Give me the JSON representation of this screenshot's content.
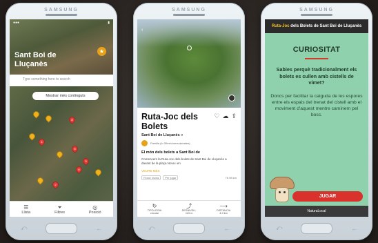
{
  "brand": "SAMSUNG",
  "screen1": {
    "title": "Sant Boi de Lluçanès",
    "search_placeholder": "Type something here to search",
    "more_button": "Mostrar més continguts",
    "tabs": [
      {
        "label": "Llista",
        "icon": "list-icon"
      },
      {
        "label": "Filtres",
        "icon": "filter-icon"
      },
      {
        "label": "Posició",
        "icon": "location-icon"
      }
    ],
    "pins": [
      {
        "color": "yellow"
      },
      {
        "color": "yellow"
      },
      {
        "color": "red",
        "label": "8"
      },
      {
        "color": "yellow"
      },
      {
        "color": "red",
        "label": "4"
      },
      {
        "color": "red",
        "label": "5"
      },
      {
        "color": "yellow"
      },
      {
        "color": "red",
        "label": "3"
      },
      {
        "color": "red",
        "label": "6"
      },
      {
        "color": "yellow"
      },
      {
        "color": "red",
        "label": "2"
      },
      {
        "color": "yellow"
      }
    ]
  },
  "screen2": {
    "photo_credit": "© ",
    "title": "Ruta-Joc dels Bolets",
    "location_link": "Sant Boi de Lluçanès »",
    "author": "Família (in 30min toma durades)",
    "heading": "El món dels bolets a Sant Boi de",
    "description": "Comencem la Ruta-Joc dels bolets de Sant Boi de Lluçanès a davant de la plaça Nova i en",
    "read_more": "VEURE MÉS",
    "tags": [
      "Flora i fauna",
      "Per jugar"
    ],
    "distance_tag": "76.98 km",
    "stats": [
      {
        "icon": "loop-icon",
        "label": "TIPOLOGIA",
        "value": "circular"
      },
      {
        "icon": "elevation-icon",
        "label": "DESNIVELL",
        "value": "120 m"
      },
      {
        "icon": "distance-icon",
        "label": "DISTÀNCIA",
        "value": "4.0 km"
      }
    ]
  },
  "screen3": {
    "header_prefix": "Ruta-Joc",
    "header_rest": " dels Bolets de Sant Boi de Lluçanès",
    "section": "CURIOSITAT",
    "question": "Sabies perquè tradicionalment els bolets es cullen amb cistells de vímet?",
    "answer": "Doncs per facilitar la caiguda de les espores entre els espais del trenat del cistell amb el moviment d'aquest mentre caminem pel bosc.",
    "play_button": "JUGAR",
    "footer": "NaturaLocal",
    "colors": {
      "background": "#8fd1ac",
      "accent": "#d9312c"
    }
  }
}
